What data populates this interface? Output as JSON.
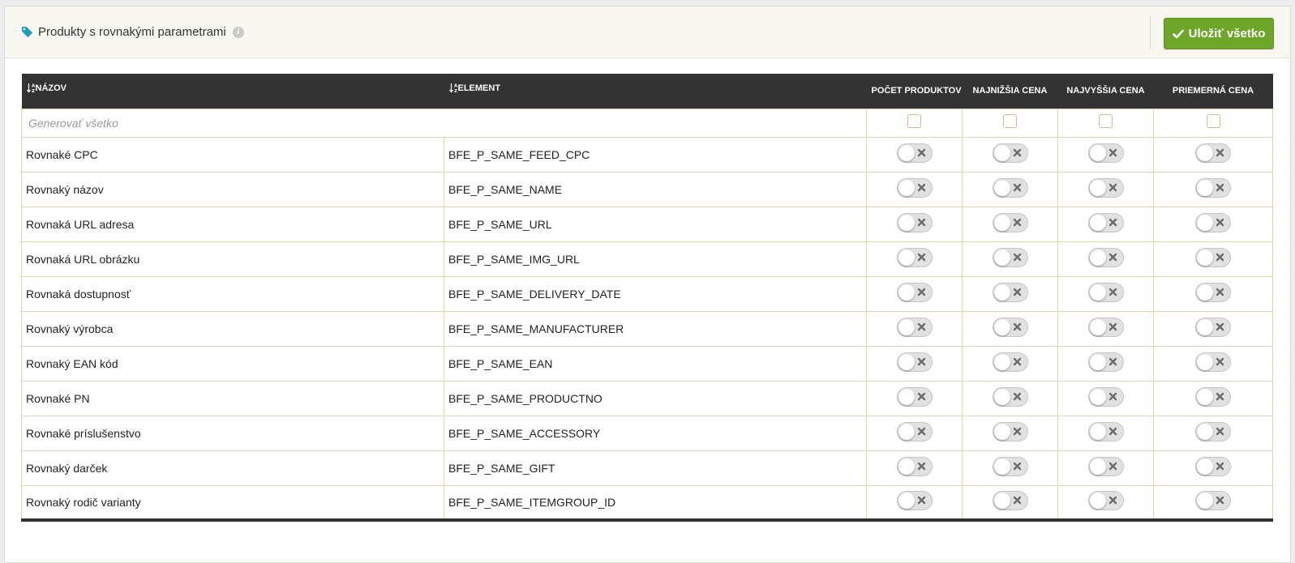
{
  "header": {
    "title": "Produkty s rovnakými parametrami",
    "save_label": "Uložiť všetko"
  },
  "table": {
    "columns": {
      "name": "NÁZOV",
      "element": "ELEMENT",
      "count": "POČET PRODUKTOV",
      "min_price": "NAJNIŽŠIA CENA",
      "max_price": "NAJVYŠŠIA CENA",
      "avg_price": "PRIEMERNÁ CENA"
    },
    "generate_all_label": "Generovať všetko",
    "rows": [
      {
        "name": "Rovnaké CPC",
        "element": "BFE_P_SAME_FEED_CPC"
      },
      {
        "name": "Rovnaký názov",
        "element": "BFE_P_SAME_NAME"
      },
      {
        "name": "Rovnaká URL adresa",
        "element": "BFE_P_SAME_URL"
      },
      {
        "name": "Rovnaká URL obrázku",
        "element": "BFE_P_SAME_IMG_URL"
      },
      {
        "name": "Rovnaká dostupnosť",
        "element": "BFE_P_SAME_DELIVERY_DATE"
      },
      {
        "name": "Rovnaký výrobca",
        "element": "BFE_P_SAME_MANUFACTURER"
      },
      {
        "name": "Rovnaký EAN kód",
        "element": "BFE_P_SAME_EAN"
      },
      {
        "name": "Rovnaké PN",
        "element": "BFE_P_SAME_PRODUCTNO"
      },
      {
        "name": "Rovnaké príslušenstvo",
        "element": "BFE_P_SAME_ACCESSORY"
      },
      {
        "name": "Rovnaký darček",
        "element": "BFE_P_SAME_GIFT"
      },
      {
        "name": "Rovnaký rodič varianty",
        "element": "BFE_P_SAME_ITEMGROUP_ID"
      }
    ],
    "toggle_state": "off"
  },
  "icons": {
    "title": "tag-icon",
    "info": "info-icon",
    "save": "check-icon",
    "sort": "sort-alpha-icon",
    "toggle": "x-icon"
  },
  "colors": {
    "accent": "#6ea728",
    "tag": "#1a9fc4",
    "table_header": "#333333",
    "cell_border": "#e3d3ae",
    "checkbox_border": "#d6b98a"
  }
}
